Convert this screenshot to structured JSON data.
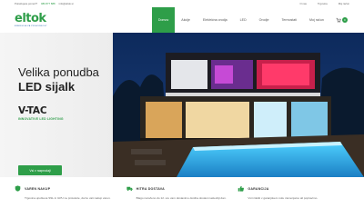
{
  "topbar": {
    "tagline": "Potrebujete pomoč?",
    "phone": "080 877 888",
    "email": "info@eltok.si",
    "links": [
      "O nas",
      "Trgovina",
      "Moj račun"
    ]
  },
  "logo": {
    "word": "eltok",
    "tag": "ENERGIJA ZA PRIHODNOST"
  },
  "nav": {
    "items": [
      {
        "label": "Domov",
        "active": true
      },
      {
        "label": "Akcije",
        "active": false
      },
      {
        "label": "Elektrićna orodja",
        "active": false
      },
      {
        "label": "LED",
        "active": false
      },
      {
        "label": "Orodje",
        "active": false
      },
      {
        "label": "Termostati",
        "active": false
      },
      {
        "label": "Moj račun",
        "active": false
      }
    ],
    "cart_count": "0"
  },
  "hero": {
    "headline_1": "Velika ponudba",
    "headline_2": "LED sijalk",
    "brand": "V-TAC",
    "brand_slogan": "INNOVATIVE LED LIGHTING",
    "cta_label": "Vsi v razprodaji"
  },
  "features": [
    {
      "title": "VAREN NAKUP",
      "icon": "shield-icon",
      "desc": "Trgovina upošteva SSL in GPU ne protokole, da bo vaš nakup varen."
    },
    {
      "title": "HITRA DOSTAVA",
      "icon": "truck-icon",
      "desc": "Blago naročeno do 12. ure vam dostavimo dostba dostavi naslednji dan."
    },
    {
      "title": "GARANCIJA",
      "icon": "thumbs-up-icon",
      "desc": "Vsi izdelki v garanjskem roku zamenjamo ali popravimo."
    }
  ],
  "colors": {
    "brand_green": "#2e9e49",
    "brand_blue": "#1f5fa8"
  }
}
